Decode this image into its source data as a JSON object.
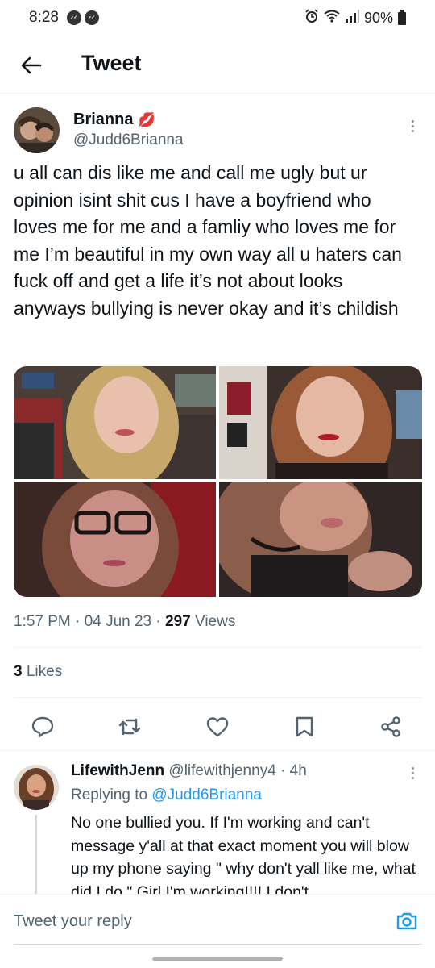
{
  "status_bar": {
    "time": "8:28",
    "battery": "90%"
  },
  "header": {
    "title": "Tweet"
  },
  "tweet": {
    "author_name": "Brianna",
    "author_handle": "@Judd6Brianna",
    "text": "u all can dis like me and call me ugly but ur opinion isint shit cus I have a boyfriend who loves me for me and a famliy who loves me for me I’m beautiful in my own way all u haters can fuck off and get a life it’s not about looks anyways bullying is never okay and it’s childish",
    "time": "1:57 PM",
    "sep1": "·",
    "date": "04 Jun 23",
    "sep2": "·",
    "views_count": "297",
    "views_label": "Views",
    "likes_count": "3",
    "likes_label": "Likes"
  },
  "reply": {
    "author_name": "LifewithJenn",
    "author_handle": "@lifewithjenny4",
    "sep": "·",
    "age": "4h",
    "replying_prefix": "Replying to",
    "replying_handle": "@Judd6Brianna",
    "text": "No one bullied you. If I'm working and can't message y'all at that exact moment you will blow up my phone saying \" why don't yall like me, what did I do \" Girl I'm working!!!! I don't"
  },
  "compose": {
    "placeholder": "Tweet your reply"
  },
  "colors": {
    "accent": "#1d9bf0",
    "text": "#0f1419",
    "secondary": "#536471",
    "border": "#eff3f4"
  }
}
